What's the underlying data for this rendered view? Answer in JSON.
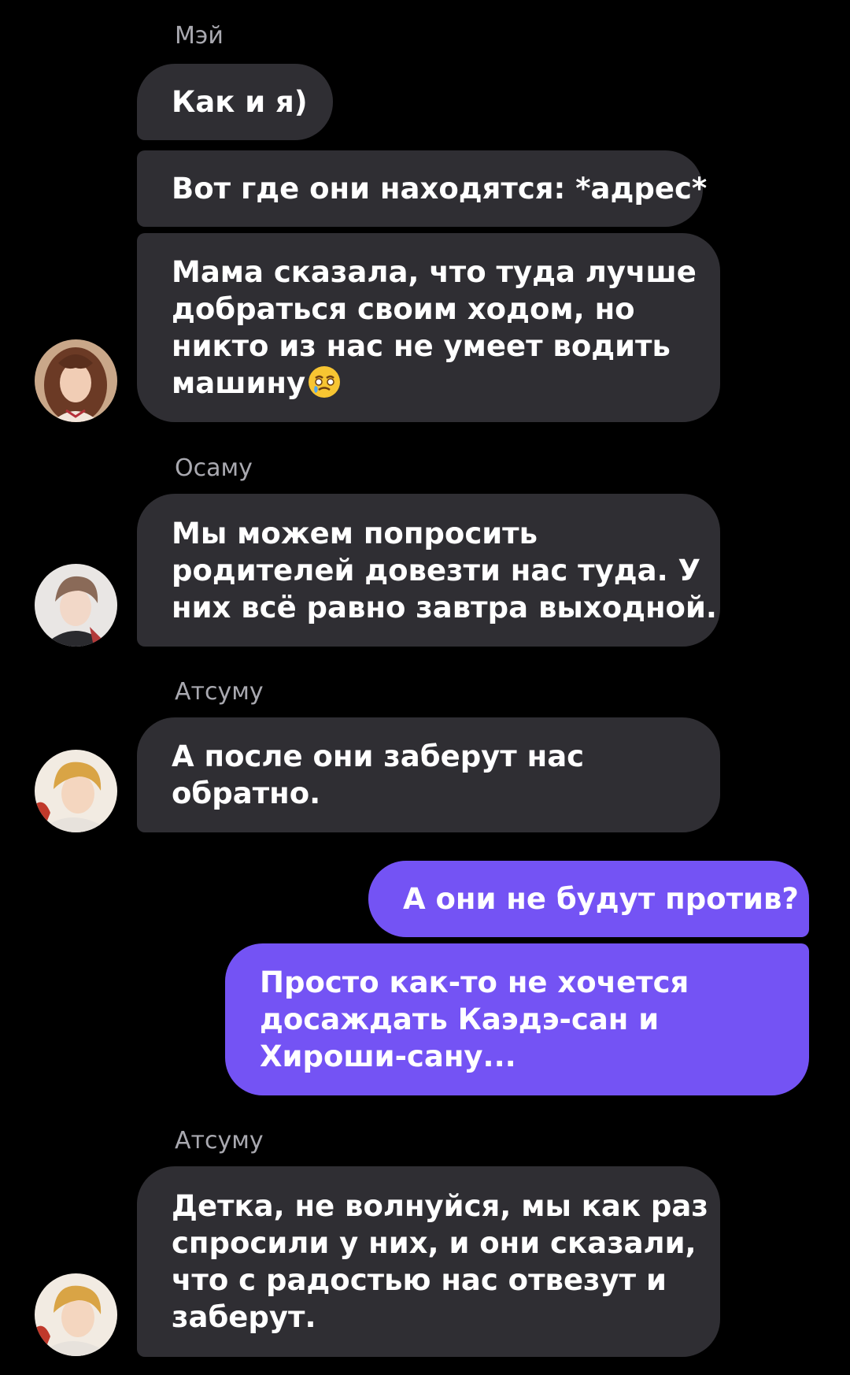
{
  "colors": {
    "background": "#000000",
    "incoming_bubble": "#2f2e33",
    "outgoing_bubble": "#7453f4",
    "sender_name": "#a9a9b0"
  },
  "messages": [
    {
      "sender": "Мэй",
      "bubbles": [
        {
          "lines": [
            "Как и я)"
          ]
        },
        {
          "lines": [
            "Вот где они находятся: *адрес*"
          ]
        },
        {
          "lines": [
            "Мама сказала, что туда лучше",
            "добраться своим ходом, но",
            "никто из нас не умеет водить",
            "машину"
          ],
          "emoji": "face-holding-back-tears-icon"
        }
      ],
      "avatar": "mei-avatar"
    },
    {
      "sender": "Осаму",
      "bubbles": [
        {
          "lines": [
            "Мы можем попросить",
            "родителей довезти нас туда. У",
            "них всё равно завтра выходной."
          ]
        }
      ],
      "avatar": "osamu-avatar"
    },
    {
      "sender": "Атсуму",
      "bubbles": [
        {
          "lines": [
            "А после они заберут нас",
            "обратно."
          ]
        }
      ],
      "avatar": "atsumu-avatar"
    },
    {
      "sender": "",
      "outgoing": true,
      "bubbles": [
        {
          "lines": [
            "А они не будут против?"
          ]
        },
        {
          "lines": [
            "Просто как-то не хочется",
            "досаждать Каэдэ-сан и",
            "Хироши-сану..."
          ]
        }
      ]
    },
    {
      "sender": "Атсуму",
      "bubbles": [
        {
          "lines": [
            "Детка, не волнуйся, мы как раз",
            "спросили у них, и они сказали,",
            "что с радостью нас отвезут и",
            "заберут."
          ]
        }
      ],
      "avatar": "atsumu-avatar"
    }
  ]
}
